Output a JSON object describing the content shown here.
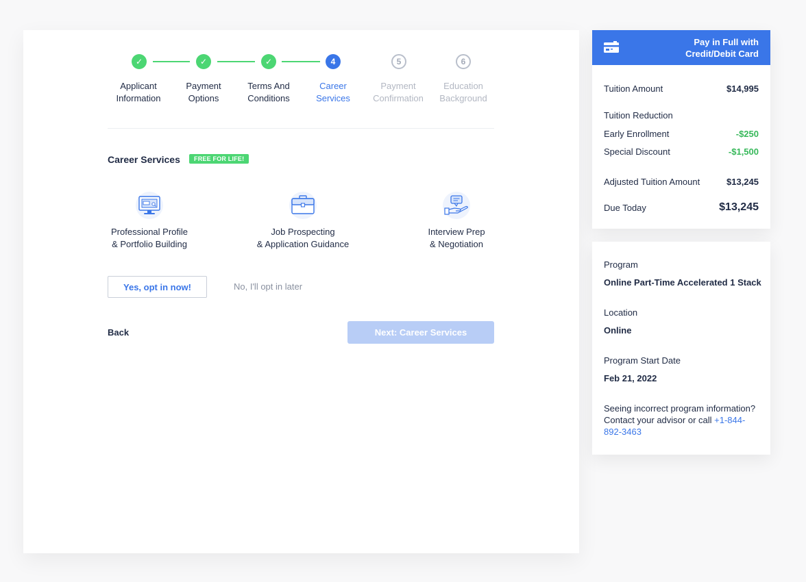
{
  "stepper": {
    "steps": [
      {
        "number": "1",
        "label": "Applicant\nInformation",
        "state": "done"
      },
      {
        "number": "2",
        "label": "Payment\nOptions",
        "state": "done"
      },
      {
        "number": "3",
        "label": "Terms And\nConditions",
        "state": "done"
      },
      {
        "number": "4",
        "label": "Career\nServices",
        "state": "active"
      },
      {
        "number": "5",
        "label": "Payment\nConfirmation",
        "state": "todo"
      },
      {
        "number": "6",
        "label": "Education\nBackground",
        "state": "todo"
      }
    ],
    "check_glyph": "✓"
  },
  "career": {
    "title": "Career Services",
    "badge": "FREE FOR LIFE!",
    "features": [
      {
        "icon": "monitor-profile-icon",
        "label": "Professional Profile\n& Portfolio Building"
      },
      {
        "icon": "briefcase-icon",
        "label": "Job Prospecting\n& Application Guidance"
      },
      {
        "icon": "hand-chat-icon",
        "label": "Interview Prep\n& Negotiation"
      }
    ],
    "opt_in_label": "Yes, opt in now!",
    "opt_later_label": "No, I'll opt in later",
    "back_label": "Back",
    "next_label": "Next: Career Services"
  },
  "payment_summary": {
    "header_title": "Pay in Full with\nCredit/Debit Card",
    "header_icon": "credit-card-icon",
    "tuition_label": "Tuition Amount",
    "tuition_value": "$14,995",
    "reduction_heading": "Tuition Reduction",
    "early_label": "Early Enrollment",
    "early_value": "-$250",
    "special_label": "Special Discount",
    "special_value": "-$1,500",
    "adjusted_label": "Adjusted Tuition Amount",
    "adjusted_value": "$13,245",
    "due_label": "Due Today",
    "due_value": "$13,245"
  },
  "program_info": {
    "program_label": "Program",
    "program_value": "Online Part-Time Accelerated 1 Stack",
    "location_label": "Location",
    "location_value": "Online",
    "start_label": "Program Start Date",
    "start_value": "Feb 21, 2022",
    "note_text": "Seeing incorrect program information? Contact your advisor or call ",
    "phone": "+1-844-892-3463"
  },
  "colors": {
    "accent": "#3a76e8",
    "success": "#4cd673",
    "disabled_button": "#b8cdf6"
  }
}
